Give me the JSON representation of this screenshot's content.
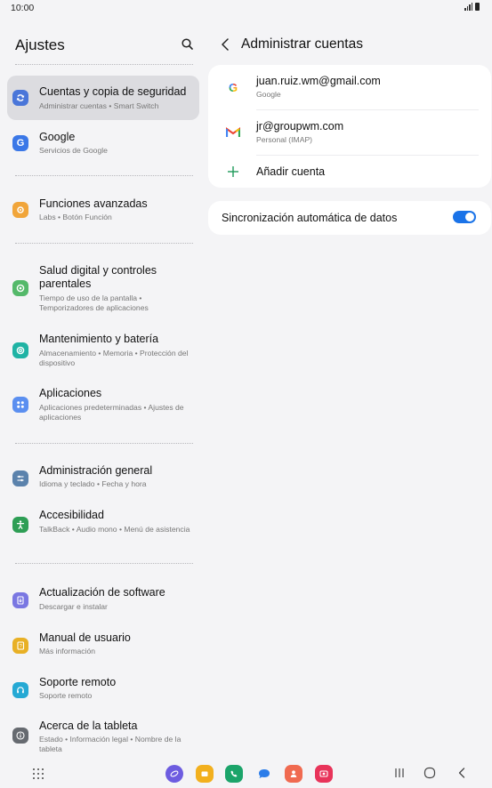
{
  "status": {
    "time": "10:00"
  },
  "left": {
    "title": "Ajustes",
    "items": [
      {
        "title": "Cuentas y copia de seguridad",
        "sub": "Administrar cuentas  •  Smart Switch",
        "icon": "sync-icon",
        "color": "#4a76d9"
      },
      {
        "title": "Google",
        "sub": "Servicios de Google",
        "icon": "google-g-icon",
        "color": "#3b78e7"
      },
      {
        "title": "Funciones avanzadas",
        "sub": "Labs  •  Botón Función",
        "icon": "gear-plus-icon",
        "color": "#f1a53a"
      },
      {
        "title": "Salud digital y controles parentales",
        "sub": "Tiempo de uso de la pantalla  •  Temporizadores de aplicaciones",
        "icon": "digital-wellbeing-icon",
        "color": "#54b96a"
      },
      {
        "title": "Mantenimiento y batería",
        "sub": "Almacenamiento  •  Memoria  •  Protección del dispositivo",
        "icon": "device-care-icon",
        "color": "#1fb3a4"
      },
      {
        "title": "Aplicaciones",
        "sub": "Aplicaciones predeterminadas  •  Ajustes de aplicaciones",
        "icon": "apps-grid-icon",
        "color": "#5b8ff0"
      },
      {
        "title": "Administración general",
        "sub": "Idioma y teclado  •  Fecha y hora",
        "icon": "sliders-icon",
        "color": "#5b82ac"
      },
      {
        "title": "Accesibilidad",
        "sub": "TalkBack  •  Audio mono  •  Menú de asistencia",
        "icon": "accessibility-icon",
        "color": "#2e9e55"
      },
      {
        "title": "Actualización de software",
        "sub": "Descargar e instalar",
        "icon": "software-update-icon",
        "color": "#7a77e2"
      },
      {
        "title": "Manual de usuario",
        "sub": "Más información",
        "icon": "user-manual-icon",
        "color": "#e8b025"
      },
      {
        "title": "Soporte remoto",
        "sub": "Soporte remoto",
        "icon": "headset-icon",
        "color": "#25a9d4"
      },
      {
        "title": "Acerca de la tableta",
        "sub": "Estado  •  Información legal  •  Nombre de la tableta",
        "icon": "info-icon",
        "color": "#666a70"
      }
    ]
  },
  "right": {
    "title": "Administrar cuentas",
    "accounts": [
      {
        "email": "juan.ruiz.wm@gmail.com",
        "type": "Google",
        "icon": "google-icon"
      },
      {
        "email": "jr@groupwm.com",
        "type": "Personal (IMAP)",
        "icon": "gmail-icon"
      }
    ],
    "add_account": "Añadir cuenta",
    "sync_label": "Sincronización automática de datos",
    "sync_on": true
  },
  "dock": {
    "apps": [
      {
        "name": "internet-app-icon",
        "color": "#6d5ce0"
      },
      {
        "name": "my-files-app-icon",
        "color": "#f2b01e"
      },
      {
        "name": "phone-app-icon",
        "color": "#1ba46a"
      },
      {
        "name": "messages-app-icon",
        "color": "#2b7de9"
      },
      {
        "name": "contacts-app-icon",
        "color": "#f06a50"
      },
      {
        "name": "screen-recorder-app-icon",
        "color": "#e8345a"
      }
    ]
  }
}
